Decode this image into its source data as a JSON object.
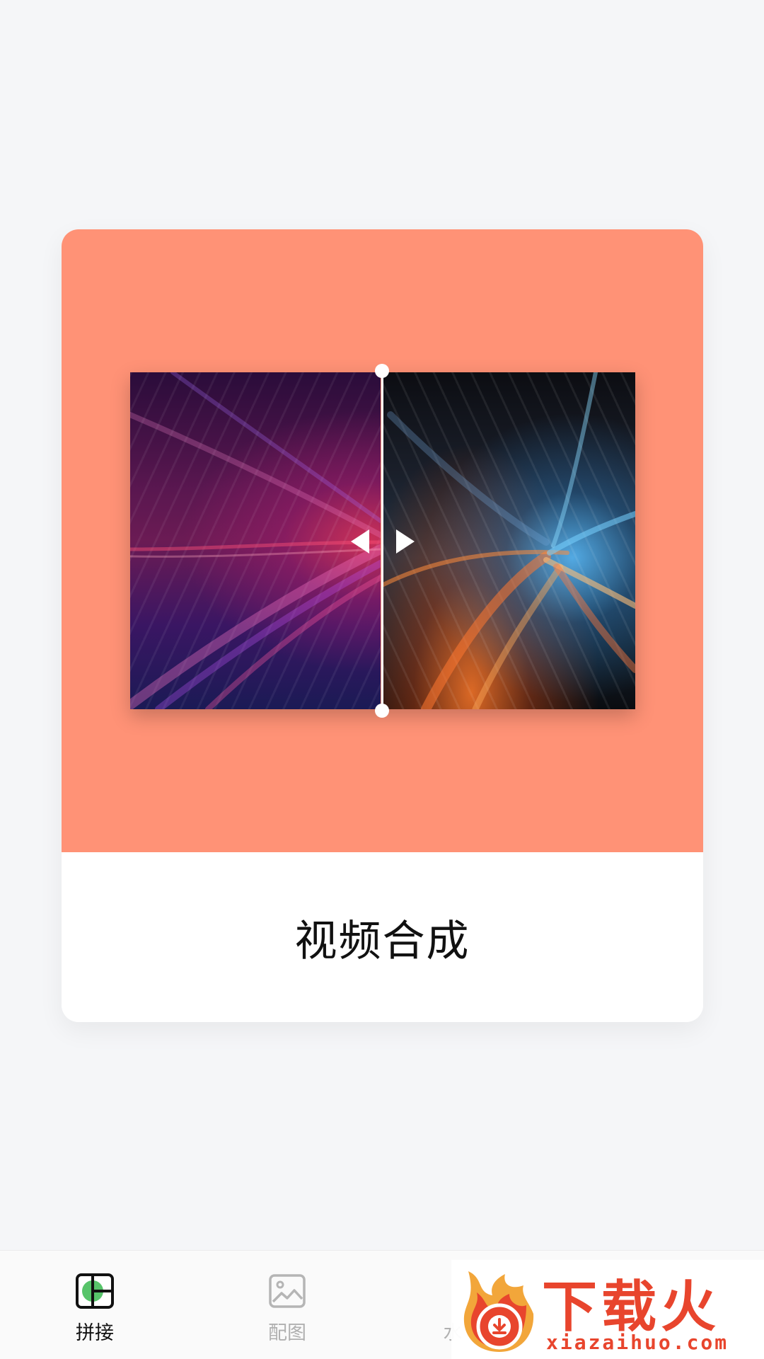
{
  "feature_card": {
    "title": "视频合成",
    "accent_color": "#ff9276"
  },
  "tabbar": {
    "tabs": [
      {
        "label": "拼接",
        "icon": "collage-icon",
        "active": true
      },
      {
        "label": "配图",
        "icon": "image-icon",
        "active": false
      },
      {
        "label": "水",
        "icon": "watermark-icon",
        "active": false
      }
    ]
  },
  "watermark": {
    "brand_cn": "下载火",
    "brand_en": "xiazaihuo.com"
  }
}
